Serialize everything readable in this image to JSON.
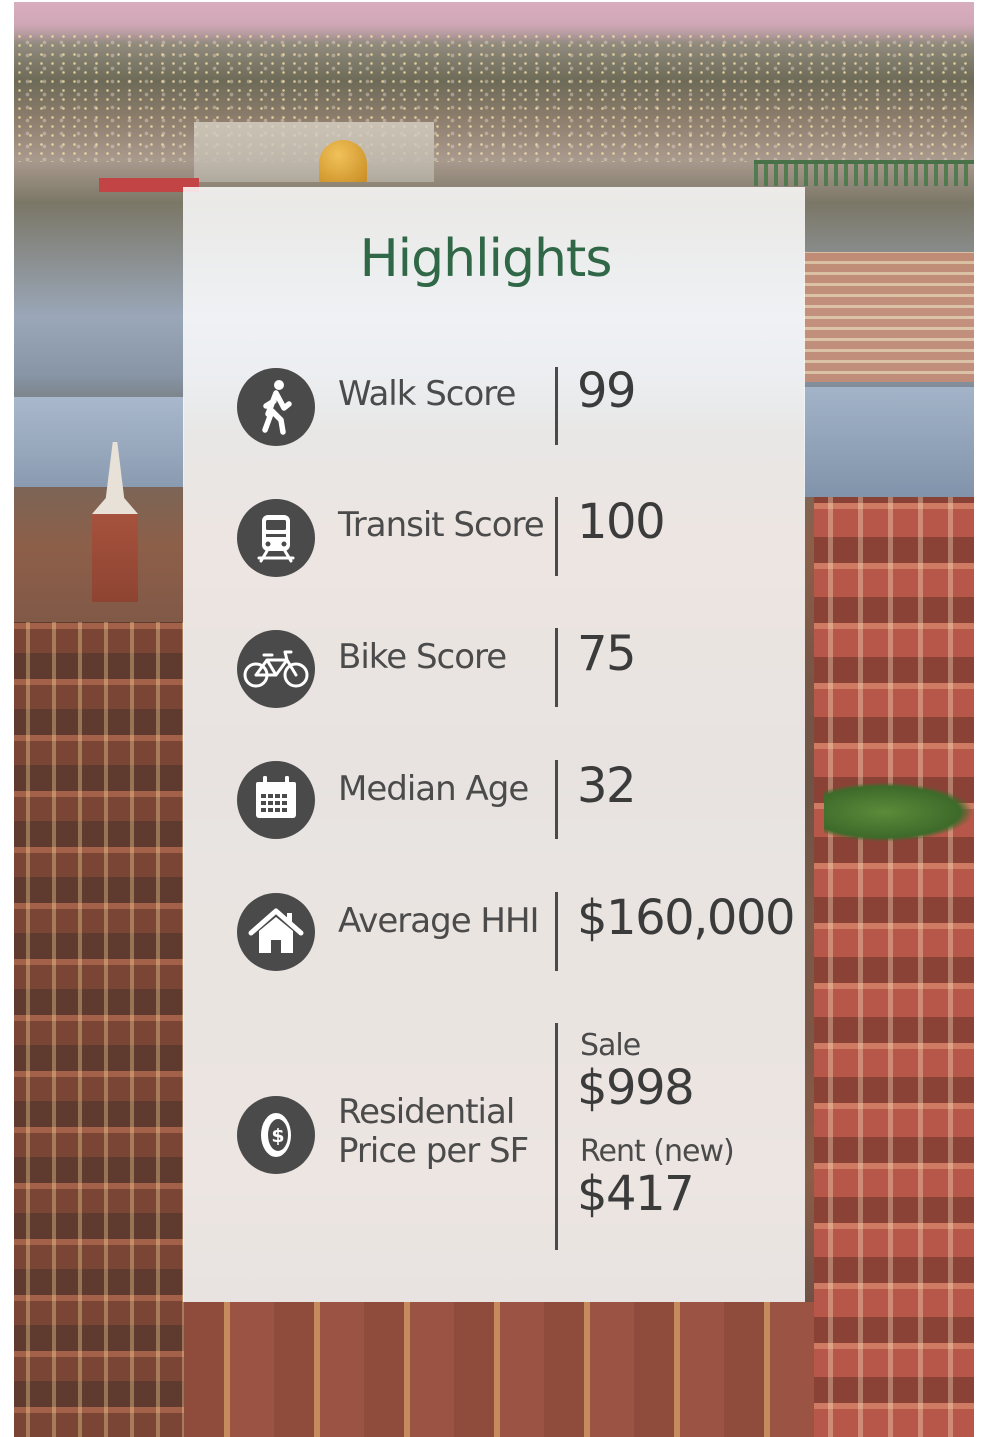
{
  "card": {
    "title": "Highlights"
  },
  "highlights": [
    {
      "label": "Walk Score",
      "value": "99",
      "icon": "pedestrian-icon"
    },
    {
      "label": "Transit Score",
      "value": "100",
      "icon": "train-icon"
    },
    {
      "label": "Bike Score",
      "value": "75",
      "icon": "bicycle-icon"
    },
    {
      "label": "Median Age",
      "value": "32",
      "icon": "calendar-icon"
    },
    {
      "label": "Average HHI",
      "value": "$160,000",
      "icon": "house-icon"
    }
  ],
  "price_per_sf": {
    "label_line1": "Residential",
    "label_line2": "Price per SF",
    "icon": "coin-icon",
    "sale_label": "Sale",
    "sale_value": "$998",
    "rent_label": "Rent (new)",
    "rent_value": "$417"
  },
  "colors": {
    "title": "#2f6747",
    "icon_background": "#4a4a4a",
    "text": "#4b4b4b"
  }
}
